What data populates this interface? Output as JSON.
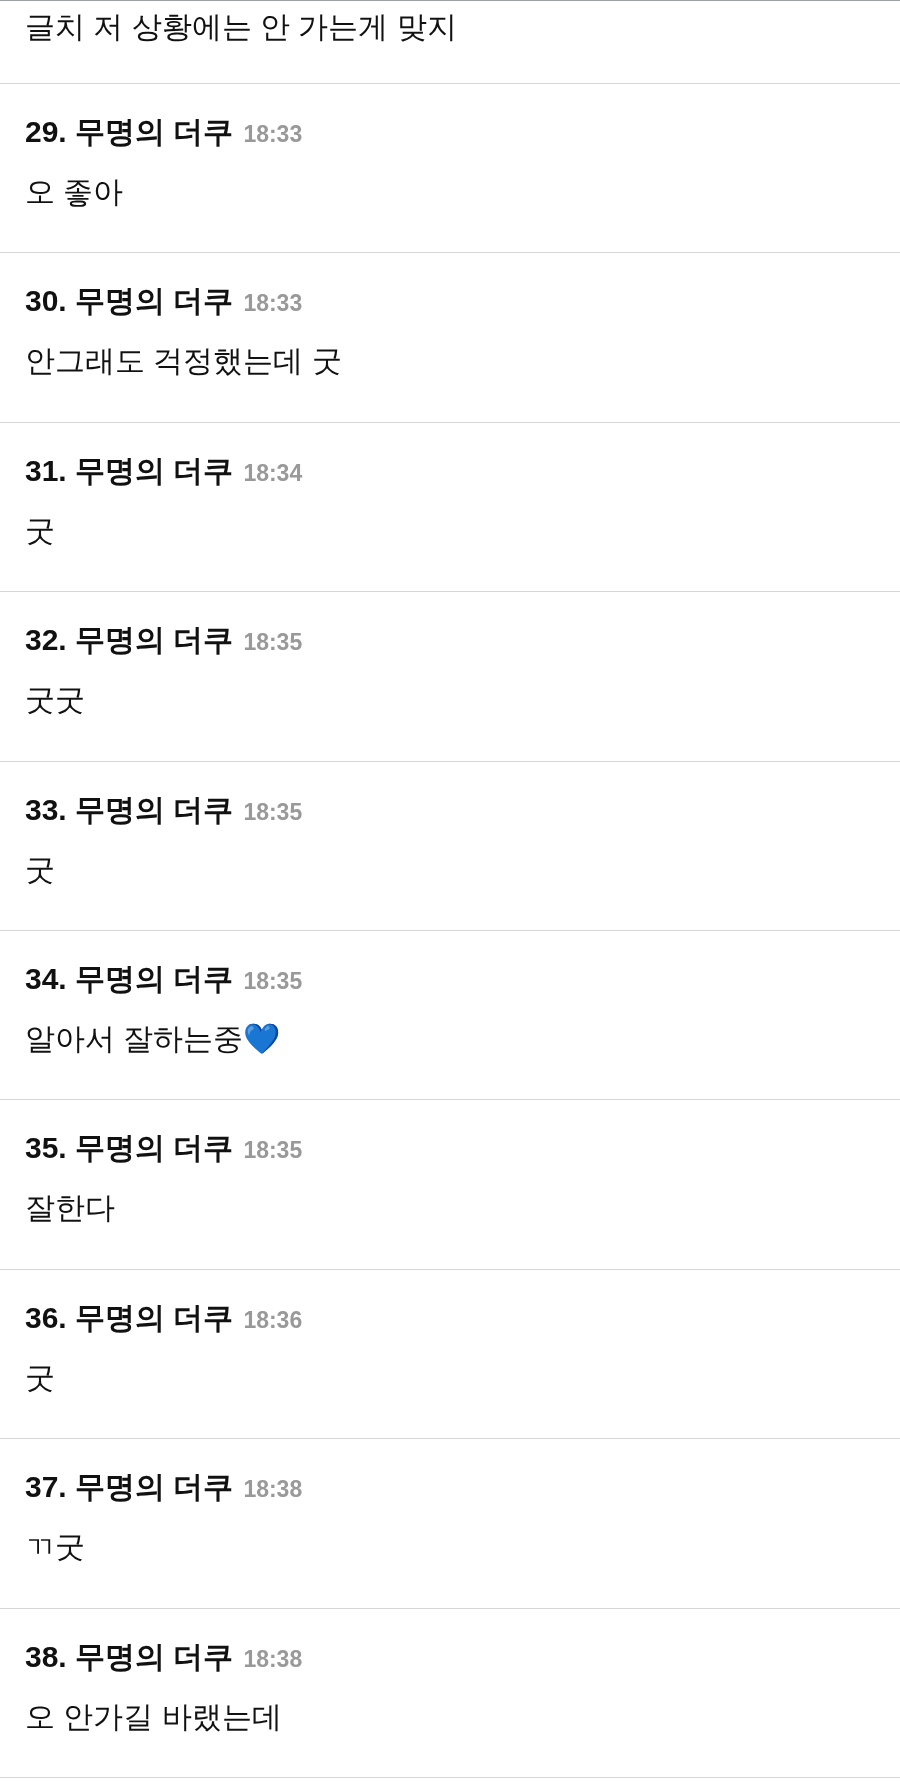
{
  "top_comment": {
    "body": "글치 저 상황에는 안 가는게 맞지"
  },
  "comments": [
    {
      "header": "29. 무명의 더쿠",
      "time": "18:33",
      "body": "오 좋아"
    },
    {
      "header": "30. 무명의 더쿠",
      "time": "18:33",
      "body": "안그래도 걱정했는데 굿"
    },
    {
      "header": "31. 무명의 더쿠",
      "time": "18:34",
      "body": "굿"
    },
    {
      "header": "32. 무명의 더쿠",
      "time": "18:35",
      "body": "굿굿"
    },
    {
      "header": "33. 무명의 더쿠",
      "time": "18:35",
      "body": "굿"
    },
    {
      "header": "34. 무명의 더쿠",
      "time": "18:35",
      "body": "알아서 잘하는중💙"
    },
    {
      "header": "35. 무명의 더쿠",
      "time": "18:35",
      "body": "잘한다"
    },
    {
      "header": "36. 무명의 더쿠",
      "time": "18:36",
      "body": "굿"
    },
    {
      "header": "37. 무명의 더쿠",
      "time": "18:38",
      "body": "ㄲ굿"
    },
    {
      "header": "38. 무명의 더쿠",
      "time": "18:38",
      "body": "오 안가길 바랬는데"
    }
  ]
}
